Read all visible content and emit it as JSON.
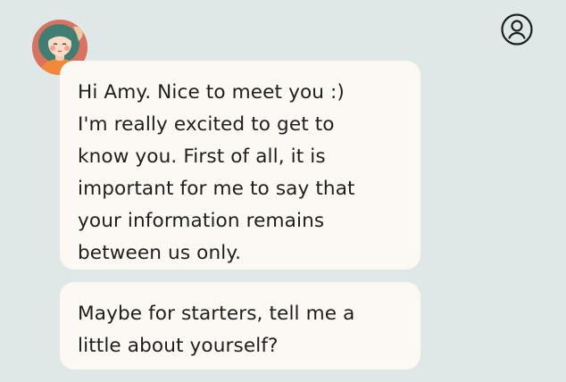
{
  "colors": {
    "background": "#dee9e7",
    "bubble": "#fcf9f4",
    "text": "#1e1e1e"
  },
  "header": {
    "avatar_icon": "assistant-avatar-illustration",
    "profile_icon": "user-profile-icon"
  },
  "messages": [
    {
      "lines": [
        "Hi Amy. Nice to meet you :)",
        "I'm really excited to get to",
        "know you. First of all, it is",
        "important for me to say that",
        "your information remains",
        "between us only."
      ]
    },
    {
      "lines": [
        "Maybe for starters, tell me a",
        "little about yourself?"
      ]
    }
  ]
}
